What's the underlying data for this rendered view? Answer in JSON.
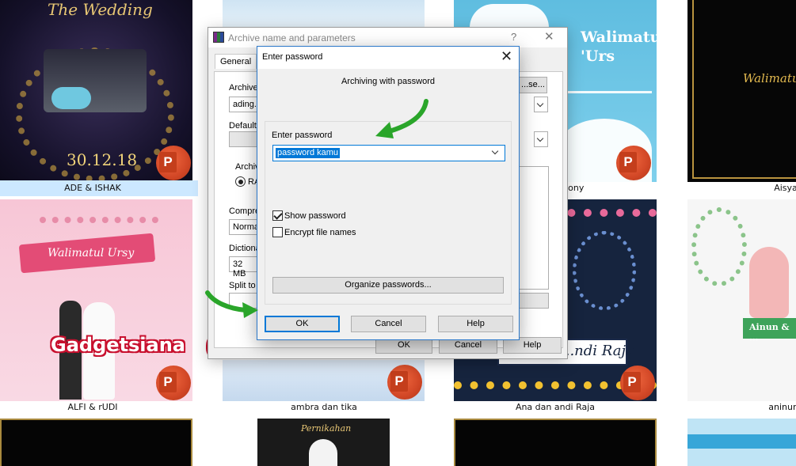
{
  "explorer": {
    "thumbnails": [
      {
        "label": "ADE & ISHAK",
        "title_text": "The Wedding",
        "date_text": "30.12.18"
      },
      {
        "label": "",
        "title_text": ""
      },
      {
        "label": "...ony",
        "title_text": "Walimatul 'Urs"
      },
      {
        "label": "Aisya & ...",
        "title_text": "Walimatu..."
      },
      {
        "label": "ALFI & rUDI",
        "title_text": "Walimatul Ursy"
      },
      {
        "label": "ambra dan tika"
      },
      {
        "label": "Ana dan andi Raja",
        "title_text": "...ndi Raja"
      },
      {
        "label": "aninun&su...",
        "title_text": "Ainun & ..."
      },
      {
        "title_text": "Pernikahan"
      }
    ],
    "watermark": "Gadgetsiana"
  },
  "background_dialog": {
    "title": "Archive name and parameters",
    "help_glyph": "?",
    "close_glyph": "✕",
    "tab_general": "General",
    "archive_label": "Archive...",
    "archive_value": "ading...",
    "browse_button": "...se...",
    "default_label": "Default...",
    "archive_format_label": "Archive...",
    "format_value": "RA...",
    "compression_label": "Compre...",
    "compression_value": "Norma...",
    "dictionary_label": "Dictiona...",
    "dictionary_value": "32 MB",
    "split_label": "Split to ...",
    "ok_label": "OK",
    "cancel_label": "Cancel",
    "help_label": "Help"
  },
  "password_dialog": {
    "title": "Enter password",
    "close_glyph": "✕",
    "heading": "Archiving with password",
    "enter_password_label": "Enter password",
    "password_value": "password kamu",
    "show_password_label": "Show password",
    "show_password_checked": true,
    "encrypt_names_label": "Encrypt file names",
    "encrypt_names_checked": false,
    "organize_button": "Organize passwords...",
    "ok_button": "OK",
    "cancel_button": "Cancel",
    "help_button": "Help"
  },
  "colors": {
    "arrow": "#2aa52a",
    "accent": "#0078d7",
    "ppt": "#d24726"
  }
}
